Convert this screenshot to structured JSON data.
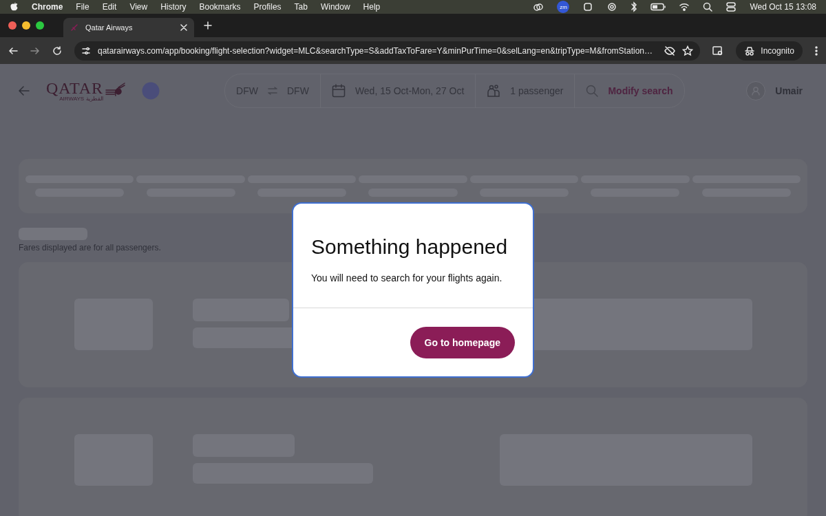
{
  "menu_bar": {
    "app": "Chrome",
    "items": [
      "File",
      "Edit",
      "View",
      "History",
      "Bookmarks",
      "Profiles",
      "Tab",
      "Window",
      "Help"
    ],
    "zoom_badge": "zm",
    "clock": "Wed Oct 15  13:08"
  },
  "browser": {
    "tabs": [
      {
        "title": "Qatar Airways",
        "selected": true
      }
    ],
    "url": "qatarairways.com/app/booking/flight-selection?widget=MLC&searchType=S&addTaxToFare=Y&minPurTime=0&selLang=en&tripType=M&fromStation…",
    "profile": "Incognito"
  },
  "header": {
    "logo": {
      "name": "QATAR",
      "sub": "AIRWAYS",
      "arabic": "القطرية"
    },
    "search_bar": {
      "from": "DFW",
      "to": "DFW",
      "dates": "Wed, 15 Oct-Mon, 27 Oct",
      "passengers": "1 passenger",
      "action": "Modify search"
    },
    "user": "Umair"
  },
  "note": "Fares displayed are for all passengers.",
  "dialog": {
    "title": "Something happened",
    "message": "You will need to search for your flights again.",
    "button": "Go to homepage"
  }
}
